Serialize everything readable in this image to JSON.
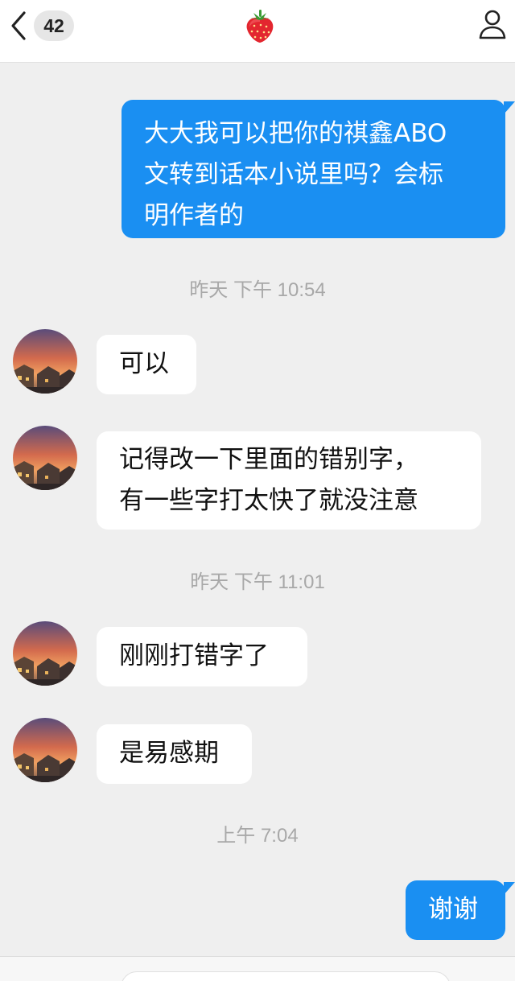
{
  "header": {
    "back_icon": "chevron-left-icon",
    "unread_count": "42",
    "title_icon": "strawberry-icon",
    "profile_icon": "person-icon"
  },
  "colors": {
    "outgoing_bubble": "#1a8ff2",
    "incoming_bubble": "#ffffff",
    "background": "#efefef",
    "timestamp": "#a8a8a8"
  },
  "messages": [
    {
      "direction": "out",
      "text": "大大我可以把你的祺鑫ABO\n文转到话本小说里吗？会标\n明作者的"
    },
    {
      "timestamp": "昨天 下午 10:54"
    },
    {
      "direction": "in",
      "text": "可以"
    },
    {
      "direction": "in",
      "text": "记得改一下里面的错别字，\n有一些字打太快了就没注意"
    },
    {
      "timestamp": "昨天 下午 11:01"
    },
    {
      "direction": "in",
      "text": "刚刚打错字了"
    },
    {
      "direction": "in",
      "text": "是易感期"
    },
    {
      "timestamp": "上午 7:04"
    },
    {
      "direction": "out",
      "text": "谢谢"
    }
  ]
}
